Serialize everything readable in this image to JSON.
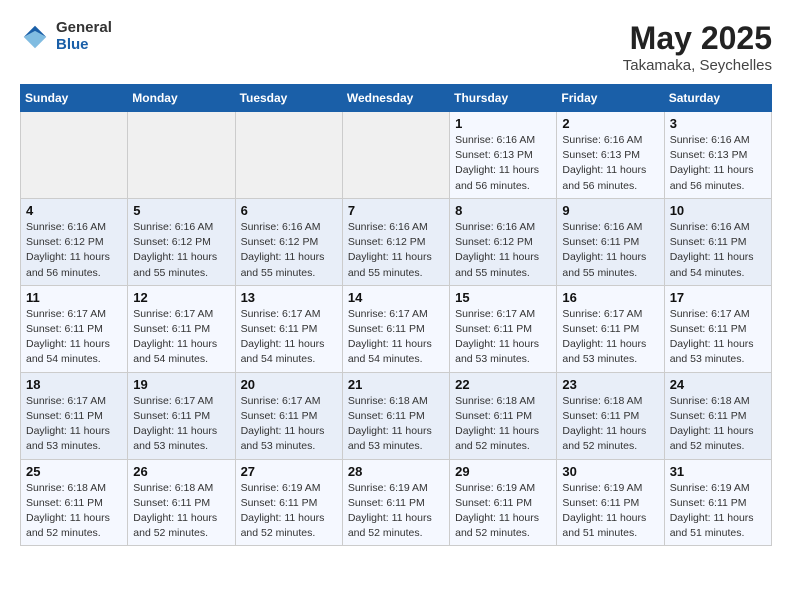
{
  "header": {
    "logo_general": "General",
    "logo_blue": "Blue",
    "month_title": "May 2025",
    "location": "Takamaka, Seychelles"
  },
  "days_of_week": [
    "Sunday",
    "Monday",
    "Tuesday",
    "Wednesday",
    "Thursday",
    "Friday",
    "Saturday"
  ],
  "weeks": [
    [
      {
        "day": "",
        "info": ""
      },
      {
        "day": "",
        "info": ""
      },
      {
        "day": "",
        "info": ""
      },
      {
        "day": "",
        "info": ""
      },
      {
        "day": "1",
        "info": "Sunrise: 6:16 AM\nSunset: 6:13 PM\nDaylight: 11 hours\nand 56 minutes."
      },
      {
        "day": "2",
        "info": "Sunrise: 6:16 AM\nSunset: 6:13 PM\nDaylight: 11 hours\nand 56 minutes."
      },
      {
        "day": "3",
        "info": "Sunrise: 6:16 AM\nSunset: 6:13 PM\nDaylight: 11 hours\nand 56 minutes."
      }
    ],
    [
      {
        "day": "4",
        "info": "Sunrise: 6:16 AM\nSunset: 6:12 PM\nDaylight: 11 hours\nand 56 minutes."
      },
      {
        "day": "5",
        "info": "Sunrise: 6:16 AM\nSunset: 6:12 PM\nDaylight: 11 hours\nand 55 minutes."
      },
      {
        "day": "6",
        "info": "Sunrise: 6:16 AM\nSunset: 6:12 PM\nDaylight: 11 hours\nand 55 minutes."
      },
      {
        "day": "7",
        "info": "Sunrise: 6:16 AM\nSunset: 6:12 PM\nDaylight: 11 hours\nand 55 minutes."
      },
      {
        "day": "8",
        "info": "Sunrise: 6:16 AM\nSunset: 6:12 PM\nDaylight: 11 hours\nand 55 minutes."
      },
      {
        "day": "9",
        "info": "Sunrise: 6:16 AM\nSunset: 6:11 PM\nDaylight: 11 hours\nand 55 minutes."
      },
      {
        "day": "10",
        "info": "Sunrise: 6:16 AM\nSunset: 6:11 PM\nDaylight: 11 hours\nand 54 minutes."
      }
    ],
    [
      {
        "day": "11",
        "info": "Sunrise: 6:17 AM\nSunset: 6:11 PM\nDaylight: 11 hours\nand 54 minutes."
      },
      {
        "day": "12",
        "info": "Sunrise: 6:17 AM\nSunset: 6:11 PM\nDaylight: 11 hours\nand 54 minutes."
      },
      {
        "day": "13",
        "info": "Sunrise: 6:17 AM\nSunset: 6:11 PM\nDaylight: 11 hours\nand 54 minutes."
      },
      {
        "day": "14",
        "info": "Sunrise: 6:17 AM\nSunset: 6:11 PM\nDaylight: 11 hours\nand 54 minutes."
      },
      {
        "day": "15",
        "info": "Sunrise: 6:17 AM\nSunset: 6:11 PM\nDaylight: 11 hours\nand 53 minutes."
      },
      {
        "day": "16",
        "info": "Sunrise: 6:17 AM\nSunset: 6:11 PM\nDaylight: 11 hours\nand 53 minutes."
      },
      {
        "day": "17",
        "info": "Sunrise: 6:17 AM\nSunset: 6:11 PM\nDaylight: 11 hours\nand 53 minutes."
      }
    ],
    [
      {
        "day": "18",
        "info": "Sunrise: 6:17 AM\nSunset: 6:11 PM\nDaylight: 11 hours\nand 53 minutes."
      },
      {
        "day": "19",
        "info": "Sunrise: 6:17 AM\nSunset: 6:11 PM\nDaylight: 11 hours\nand 53 minutes."
      },
      {
        "day": "20",
        "info": "Sunrise: 6:17 AM\nSunset: 6:11 PM\nDaylight: 11 hours\nand 53 minutes."
      },
      {
        "day": "21",
        "info": "Sunrise: 6:18 AM\nSunset: 6:11 PM\nDaylight: 11 hours\nand 53 minutes."
      },
      {
        "day": "22",
        "info": "Sunrise: 6:18 AM\nSunset: 6:11 PM\nDaylight: 11 hours\nand 52 minutes."
      },
      {
        "day": "23",
        "info": "Sunrise: 6:18 AM\nSunset: 6:11 PM\nDaylight: 11 hours\nand 52 minutes."
      },
      {
        "day": "24",
        "info": "Sunrise: 6:18 AM\nSunset: 6:11 PM\nDaylight: 11 hours\nand 52 minutes."
      }
    ],
    [
      {
        "day": "25",
        "info": "Sunrise: 6:18 AM\nSunset: 6:11 PM\nDaylight: 11 hours\nand 52 minutes."
      },
      {
        "day": "26",
        "info": "Sunrise: 6:18 AM\nSunset: 6:11 PM\nDaylight: 11 hours\nand 52 minutes."
      },
      {
        "day": "27",
        "info": "Sunrise: 6:19 AM\nSunset: 6:11 PM\nDaylight: 11 hours\nand 52 minutes."
      },
      {
        "day": "28",
        "info": "Sunrise: 6:19 AM\nSunset: 6:11 PM\nDaylight: 11 hours\nand 52 minutes."
      },
      {
        "day": "29",
        "info": "Sunrise: 6:19 AM\nSunset: 6:11 PM\nDaylight: 11 hours\nand 52 minutes."
      },
      {
        "day": "30",
        "info": "Sunrise: 6:19 AM\nSunset: 6:11 PM\nDaylight: 11 hours\nand 51 minutes."
      },
      {
        "day": "31",
        "info": "Sunrise: 6:19 AM\nSunset: 6:11 PM\nDaylight: 11 hours\nand 51 minutes."
      }
    ]
  ]
}
